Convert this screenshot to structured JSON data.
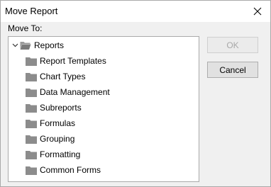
{
  "dialog": {
    "title": "Move Report",
    "move_to_label": "Move To:"
  },
  "tree": {
    "root": {
      "label": "Reports",
      "expanded": true,
      "icon": "folder-open-icon"
    },
    "children": [
      {
        "label": "Report Templates",
        "icon": "folder-icon"
      },
      {
        "label": "Chart Types",
        "icon": "folder-icon"
      },
      {
        "label": "Data Management",
        "icon": "folder-icon"
      },
      {
        "label": "Subreports",
        "icon": "folder-icon"
      },
      {
        "label": "Formulas",
        "icon": "folder-icon"
      },
      {
        "label": "Grouping",
        "icon": "folder-icon"
      },
      {
        "label": "Formatting",
        "icon": "folder-icon"
      },
      {
        "label": "Common Forms",
        "icon": "folder-icon"
      }
    ]
  },
  "buttons": {
    "ok_label": "OK",
    "ok_enabled": false,
    "cancel_label": "Cancel"
  },
  "colors": {
    "dialog_bg": "#f0f0f0",
    "folder_gray": "#8c8c8c",
    "disabled_text": "#a8a8a8"
  }
}
